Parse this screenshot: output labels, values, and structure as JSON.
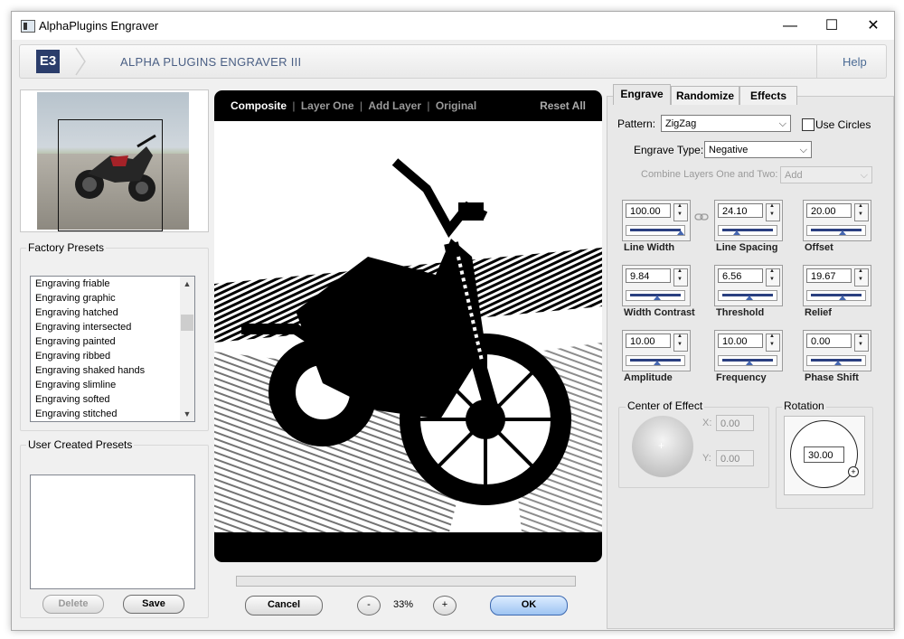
{
  "window": {
    "title": "AlphaPlugins Engraver",
    "minimize": "—",
    "maximize": "☐",
    "close": "✕"
  },
  "header": {
    "logo": "E3",
    "app_title": "ALPHA PLUGINS ENGRAVER III",
    "help": "Help"
  },
  "factory_presets": {
    "label": "Factory Presets",
    "items": [
      "Engraving friable",
      "Engraving graphic",
      "Engraving hatched",
      "Engraving intersected",
      "Engraving painted",
      "Engraving ribbed",
      "Engraving shaked hands",
      "Engraving slimline",
      "Engraving softed",
      "Engraving stitched"
    ]
  },
  "user_presets": {
    "label": "User Created Presets",
    "delete": "Delete",
    "save": "Save"
  },
  "preview": {
    "tabs": [
      "Composite",
      "Layer One",
      "Add Layer",
      "Original"
    ],
    "separator": "|",
    "reset_all": "Reset All"
  },
  "bottom": {
    "cancel": "Cancel",
    "zoom_out": "-",
    "zoom": "33%",
    "zoom_in": "+",
    "ok": "OK"
  },
  "tabs": [
    "Engrave",
    "Randomize",
    "Effects"
  ],
  "engrave": {
    "pattern_label": "Pattern:",
    "pattern_value": "ZigZag",
    "use_circles": "Use Circles",
    "type_label": "Engrave Type:",
    "type_value": "Negative",
    "combine_label": "Combine Layers One and Two:",
    "combine_value": "Add",
    "controls": [
      {
        "label": "Line Width",
        "value": "100.00",
        "level": 1.0
      },
      {
        "label": "Line Spacing",
        "value": "24.10",
        "level": 0.24
      },
      {
        "label": "Offset",
        "value": "20.00",
        "level": 0.6
      },
      {
        "label": "Width Contrast",
        "value": "9.84",
        "level": 0.5
      },
      {
        "label": "Threshold",
        "value": "6.56",
        "level": 0.5
      },
      {
        "label": "Relief",
        "value": "19.67",
        "level": 0.6
      },
      {
        "label": "Amplitude",
        "value": "10.00",
        "level": 0.5
      },
      {
        "label": "Frequency",
        "value": "10.00",
        "level": 0.5
      },
      {
        "label": "Phase Shift",
        "value": "0.00",
        "level": 0.5
      }
    ],
    "center_label": "Center of Effect",
    "x_label": "X:",
    "x_value": "0.00",
    "y_label": "Y:",
    "y_value": "0.00",
    "rotation_label": "Rotation",
    "rotation_value": "30.00"
  },
  "colors": {
    "accent_blue": "#2a3f80",
    "ok_button": "#b8d3f5",
    "logo_bg": "#2b3d6b"
  }
}
